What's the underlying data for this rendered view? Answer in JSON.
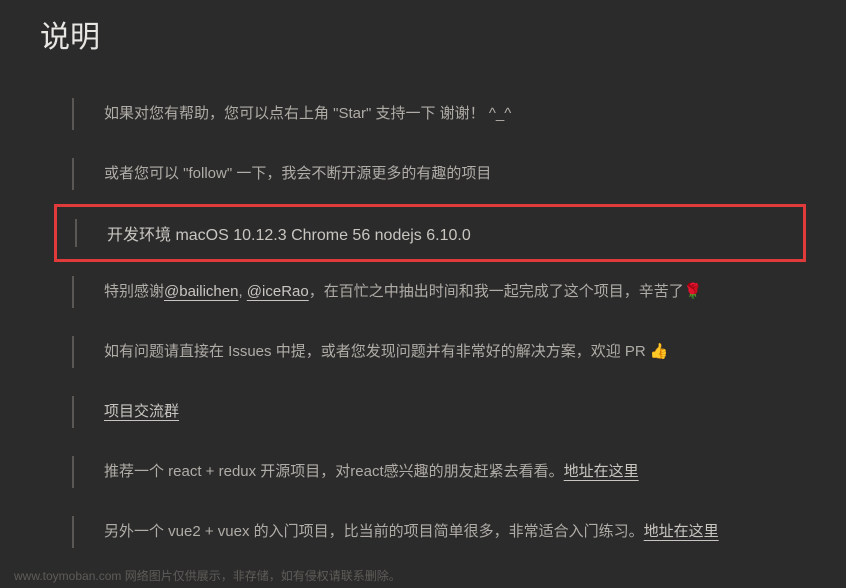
{
  "heading": "说明",
  "items": {
    "help_star": "如果对您有帮助，您可以点右上角 \"Star\" 支持一下 谢谢！ ^_^",
    "follow": "或者您可以 \"follow\" 一下，我会不断开源更多的有趣的项目",
    "dev_env": "开发环境 macOS 10.12.3  Chrome 56  nodejs 6.10.0",
    "thanks_prefix": "特别感谢",
    "thanks_link1": "@bailichen",
    "thanks_mid": ", ",
    "thanks_link2": "@iceRao",
    "thanks_suffix": "，在百忙之中抽出时间和我一起完成了这个项目，辛苦了",
    "rose_emoji": "🌹",
    "issues_text": "如有问题请直接在 Issues 中提，或者您发现问题并有非常好的解决方案，欢迎 PR ",
    "thumbs_emoji": "👍",
    "group_link": "项目交流群",
    "react_text": "推荐一个 react + redux 开源项目，对react感兴趣的朋友赶紧去看看。",
    "react_link": "地址在这里",
    "vue_text": "另外一个 vue2 + vuex 的入门项目，比当前的项目简单很多，非常适合入门练习。",
    "vue_link": "地址在这里"
  },
  "footer": "www.toymoban.com  网络图片仅供展示，非存储，如有侵权请联系删除。"
}
